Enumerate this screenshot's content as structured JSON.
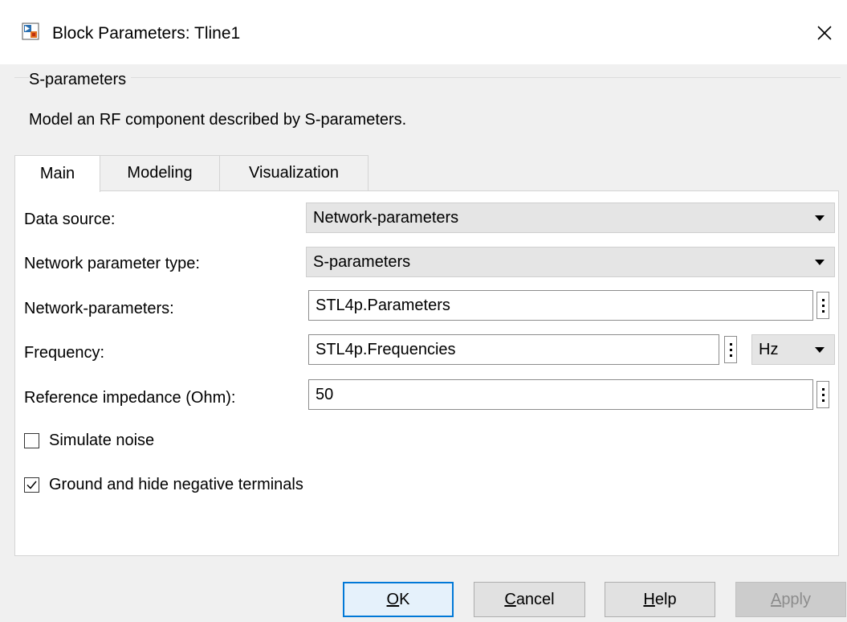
{
  "window": {
    "title": "Block Parameters: Tline1",
    "icon": "simulink-block-icon",
    "close_icon": "close-icon"
  },
  "group": {
    "title": "S-parameters",
    "description": "Model an RF component described by S-parameters."
  },
  "tabs": [
    {
      "label": "Main",
      "active": true
    },
    {
      "label": "Modeling",
      "active": false
    },
    {
      "label": "Visualization",
      "active": false
    }
  ],
  "form": {
    "data_source": {
      "label": "Data source:",
      "value": "Network-parameters"
    },
    "network_parameter_type": {
      "label": "Network parameter type:",
      "value": "S-parameters"
    },
    "network_parameters": {
      "label": "Network-parameters:",
      "value": "STL4p.Parameters"
    },
    "frequency": {
      "label": "Frequency:",
      "value": "STL4p.Frequencies",
      "unit": "Hz"
    },
    "reference_impedance": {
      "label": "Reference impedance (Ohm):",
      "value": "50"
    },
    "simulate_noise": {
      "label": "Simulate noise",
      "checked": false
    },
    "ground_hide": {
      "label": "Ground and hide negative terminals",
      "checked": true
    }
  },
  "buttons": {
    "ok": {
      "prefix": "",
      "mnemonic": "O",
      "rest": "K"
    },
    "cancel": {
      "prefix": "",
      "mnemonic": "C",
      "rest": "ancel"
    },
    "help": {
      "prefix": "",
      "mnemonic": "H",
      "rest": "elp"
    },
    "apply": {
      "prefix": "",
      "mnemonic": "A",
      "rest": "pply",
      "disabled": true
    }
  },
  "colors": {
    "accent": "#0078d7",
    "background": "#f0f0f0",
    "panel": "#ffffff"
  }
}
